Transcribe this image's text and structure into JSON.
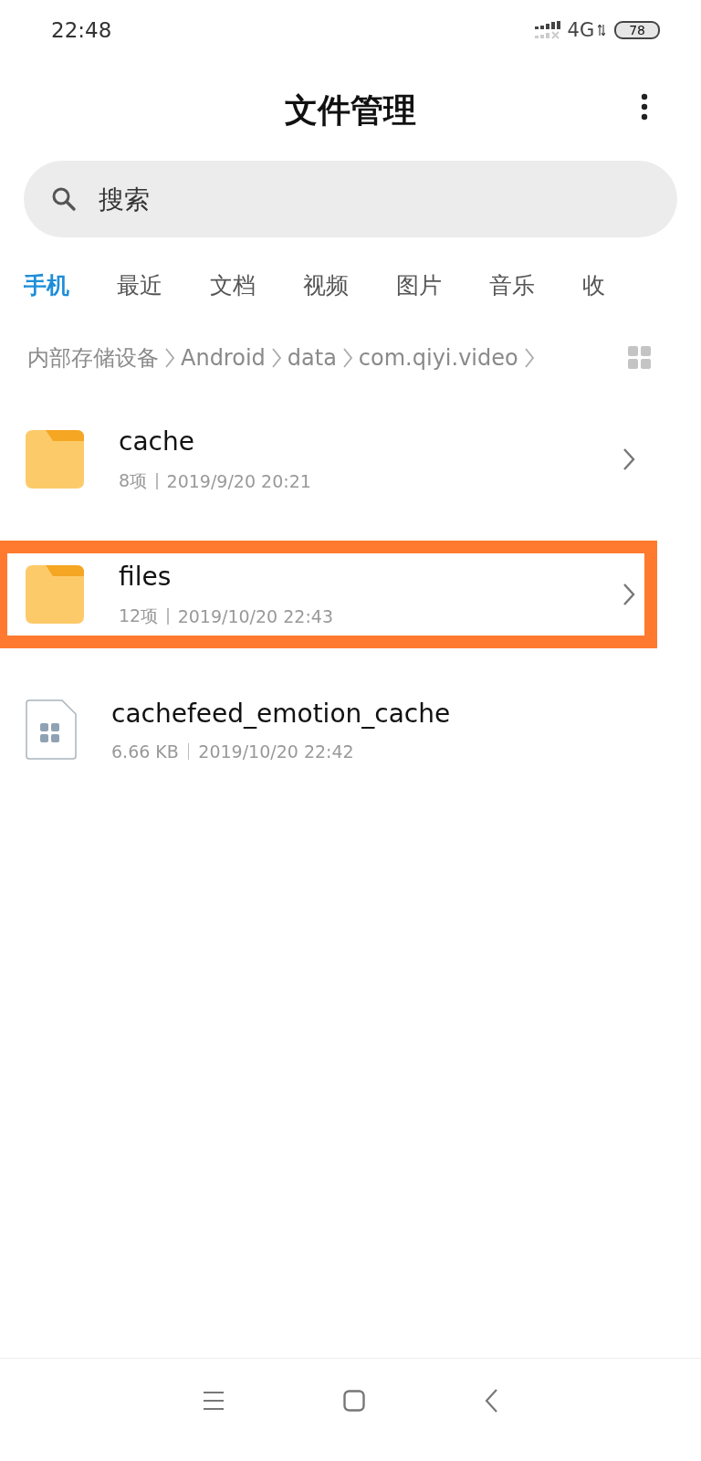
{
  "status_bar": {
    "time": "22:48",
    "network": "4G",
    "battery": "78"
  },
  "header": {
    "title": "文件管理"
  },
  "search": {
    "placeholder": "搜索"
  },
  "tabs": [
    {
      "label": "手机",
      "selected": true
    },
    {
      "label": "最近",
      "selected": false
    },
    {
      "label": "文档",
      "selected": false
    },
    {
      "label": "视频",
      "selected": false
    },
    {
      "label": "图片",
      "selected": false
    },
    {
      "label": "音乐",
      "selected": false
    },
    {
      "label": "收",
      "selected": false
    }
  ],
  "breadcrumb": [
    "内部存储设备",
    "Android",
    "data",
    "com.qiyi.video"
  ],
  "files": [
    {
      "kind": "folder",
      "name": "cache",
      "count": "8项",
      "date": "2019/9/20 20:21",
      "highlighted": false
    },
    {
      "kind": "folder",
      "name": "files",
      "count": "12项",
      "date": "2019/10/20 22:43",
      "highlighted": true
    },
    {
      "kind": "file",
      "name": "cachefeed_emotion_cache",
      "count": "6.66 KB",
      "date": "2019/10/20 22:42",
      "highlighted": false
    }
  ]
}
